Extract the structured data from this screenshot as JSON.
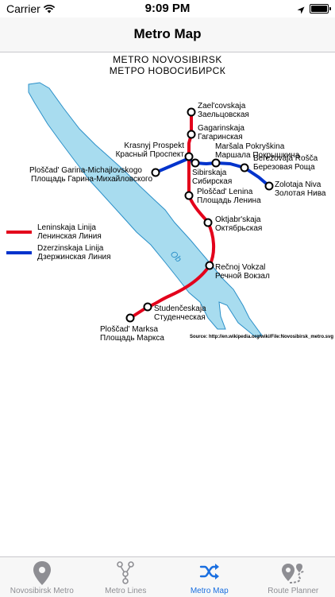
{
  "status_bar": {
    "carrier": "Carrier",
    "time": "9:09 PM"
  },
  "nav": {
    "title": "Metro Map"
  },
  "map": {
    "title_latin": "METRO NOVOSIBIRSK",
    "title_cyrillic": "МЕТРО НОВОСИБИРСК",
    "river_label": "Ob",
    "source": "Source: http://en.wikipedia.org/wiki/File:Novosibirsk_metro.svg",
    "legend": [
      {
        "latin": "Leninskaja Linija",
        "cyrillic": "Ленинская Линия",
        "color": "#e3001b"
      },
      {
        "latin": "Dzerzinskaja Linija",
        "cyrillic": "Дзержинская Линия",
        "color": "#0033cc"
      }
    ],
    "stations": [
      {
        "latin": "Zael'covskaja",
        "cyrillic": "Заельцовская"
      },
      {
        "latin": "Gagarinskaja",
        "cyrillic": "Гагаринская"
      },
      {
        "latin": "Krasnyj Prospekt",
        "cyrillic": "Красный Проспект"
      },
      {
        "latin": "Maršala Pokryškina",
        "cyrillic": "Маршала Покрышкина"
      },
      {
        "latin": "Berezovaja Rošča",
        "cyrillic": "Березовая Роща"
      },
      {
        "latin": "Ploščad' Garina-Michajlovskogo",
        "cyrillic": "Площадь Гарина-Михайловского"
      },
      {
        "latin": "Sibirskaja",
        "cyrillic": "Сибирская"
      },
      {
        "latin": "Zolotaja Niva",
        "cyrillic": "Золотая Нива"
      },
      {
        "latin": "Ploščad' Lenina",
        "cyrillic": "Площадь Ленина"
      },
      {
        "latin": "Oktjabr'skaja",
        "cyrillic": "Октябрьская"
      },
      {
        "latin": "Rečnoj Vokzal",
        "cyrillic": "Речной Вокзал"
      },
      {
        "latin": "Studenčeskaja",
        "cyrillic": "Студенческая"
      },
      {
        "latin": "Ploščad' Marksa",
        "cyrillic": "Площадь Маркса"
      }
    ]
  },
  "tabs": [
    {
      "label": "Novosibirsk Metro",
      "icon": "map-pin-icon",
      "active": false
    },
    {
      "label": "Metro Lines",
      "icon": "network-icon",
      "active": false
    },
    {
      "label": "Metro Map",
      "icon": "shuffle-icon",
      "active": true
    },
    {
      "label": "Route Planner",
      "icon": "route-pin-icon",
      "active": false
    }
  ],
  "colors": {
    "accent": "#1a6fe0",
    "river": "#a8dcef",
    "line_red": "#e3001b",
    "line_blue": "#0033cc"
  }
}
